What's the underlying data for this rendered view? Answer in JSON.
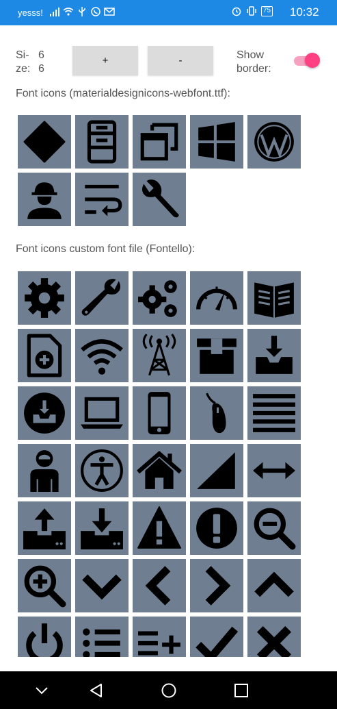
{
  "status_bar": {
    "carrier": "yesss!",
    "battery": "75",
    "time": "10:32",
    "background": "#1e88e5"
  },
  "controls": {
    "size_label": "Si-\nze:",
    "size_width": "6",
    "size_height": "6",
    "plus_label": "+",
    "minus_label": "-",
    "show_border_label": "Show\nborder:",
    "show_border_on": true,
    "accent": "#ff4081"
  },
  "section_font_icons": {
    "title": "Font icons (materialdesignicons-webfont.ttf):",
    "icons": [
      "rhombus-icon",
      "wardrobe-icon",
      "window-restore-icon",
      "windows-logo-icon",
      "wordpress-logo-icon",
      "worker-icon",
      "wrap-text-icon",
      "wrench-icon"
    ]
  },
  "section_custom_icons": {
    "title": "Font icons custom font file (Fontello):",
    "icons": [
      "gear-icon",
      "wrench-icon",
      "gears-icon",
      "gauge-icon",
      "book-open-icon",
      "file-add-icon",
      "wifi-icon",
      "antenna-tower-icon",
      "box-icon",
      "inbox-download-icon",
      "download-circle-icon",
      "laptop-icon",
      "smartphone-icon",
      "mouse-icon",
      "menu-lines-icon",
      "user-icon",
      "accessibility-icon",
      "home-icon",
      "signal-icon",
      "resize-horizontal-icon",
      "upload-drive-icon",
      "download-drive-icon",
      "warning-icon",
      "exclamation-circle-icon",
      "zoom-out-icon",
      "zoom-in-icon",
      "chevron-down-icon",
      "chevron-left-icon",
      "chevron-right-icon",
      "chevron-up-icon",
      "power-icon",
      "list-icon",
      "list-add-icon",
      "check-icon",
      "close-icon"
    ]
  },
  "tile_color": "#6f7f91",
  "nav_bar": {
    "buttons": [
      "nav-down-icon",
      "nav-back-icon",
      "nav-home-icon",
      "nav-recents-icon"
    ]
  }
}
